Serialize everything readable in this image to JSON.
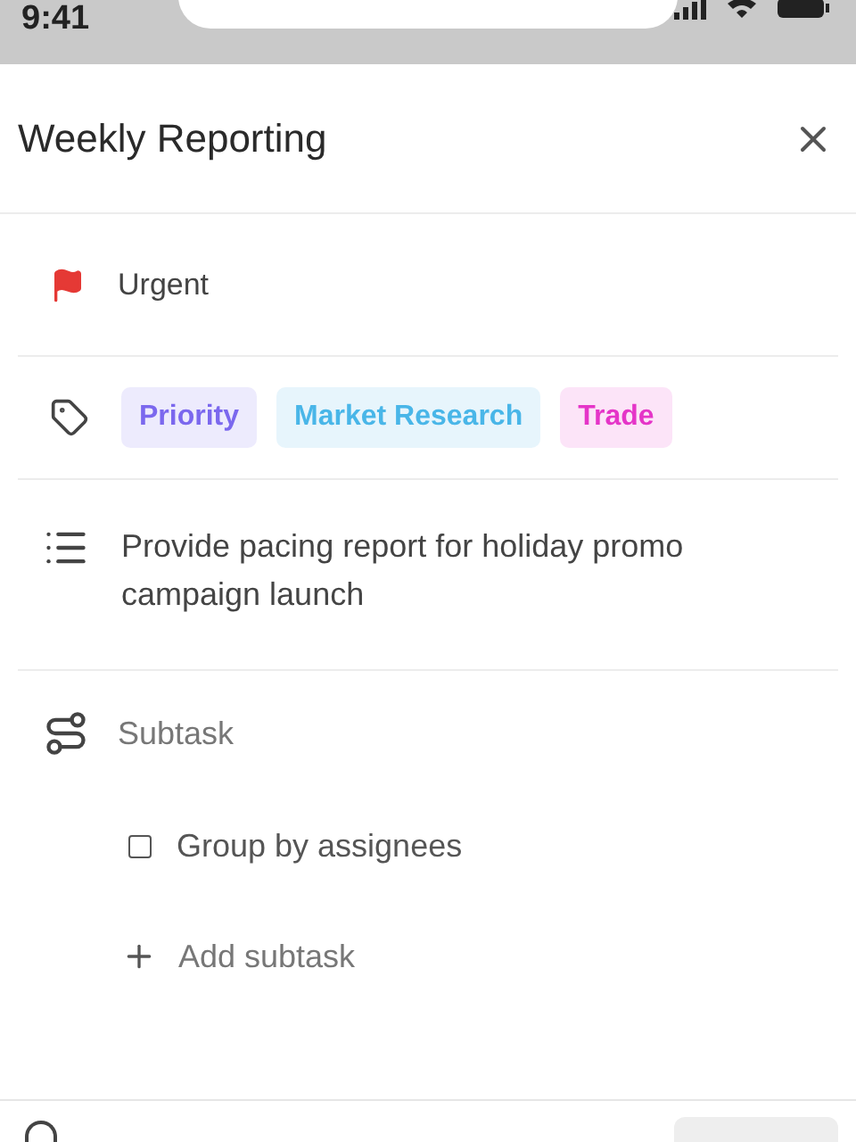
{
  "status_bar": {
    "time": "9:41"
  },
  "title": "Weekly Reporting",
  "priority": {
    "label": "Urgent"
  },
  "tags": [
    {
      "label": "Priority",
      "color": "#7b68ee"
    },
    {
      "label": "Market Research",
      "color": "#49b6e8"
    },
    {
      "label": "Trade",
      "color": "#e535c8"
    }
  ],
  "description": "Provide pacing report for holiday promo campaign launch",
  "subtasks": {
    "label": "Subtask",
    "items": [
      {
        "label": "Group by assignees",
        "checked": false
      }
    ],
    "add_label": "Add subtask"
  }
}
